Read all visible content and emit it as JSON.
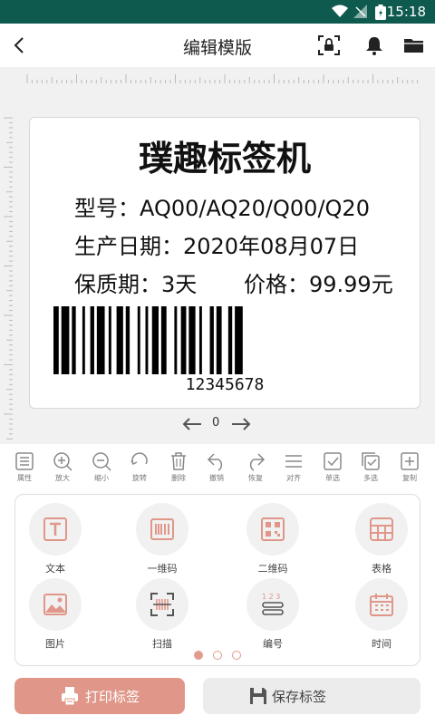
{
  "status_bar": {
    "time": "15:18"
  },
  "header": {
    "title": "编辑模版"
  },
  "label": {
    "title": "璞趣标签机",
    "model": "型号：AQ00/AQ20/Q00/Q20",
    "date": "生产日期：2020年08月07日",
    "shelf_life": "保质期：3天",
    "price": "价格：99.99元",
    "barcode_number": "12345678"
  },
  "pager": {
    "current": "0"
  },
  "toolbar": {
    "items": [
      {
        "label": "属性",
        "icon": "list-icon"
      },
      {
        "label": "放大",
        "icon": "zoom-in-icon"
      },
      {
        "label": "缩小",
        "icon": "zoom-out-icon"
      },
      {
        "label": "旋转",
        "icon": "rotate-icon"
      },
      {
        "label": "删除",
        "icon": "trash-icon"
      },
      {
        "label": "撤销",
        "icon": "undo-icon"
      },
      {
        "label": "恢复",
        "icon": "redo-icon"
      },
      {
        "label": "对齐",
        "icon": "align-icon"
      },
      {
        "label": "单选",
        "icon": "checkbox-icon"
      },
      {
        "label": "多选",
        "icon": "multi-select-icon"
      },
      {
        "label": "复制",
        "icon": "copy-icon"
      }
    ]
  },
  "panel": {
    "items": [
      {
        "label": "文本",
        "icon": "text-icon"
      },
      {
        "label": "一维码",
        "icon": "barcode-icon"
      },
      {
        "label": "二维码",
        "icon": "qrcode-icon"
      },
      {
        "label": "表格",
        "icon": "table-icon"
      },
      {
        "label": "图片",
        "icon": "image-icon"
      },
      {
        "label": "扫描",
        "icon": "scan-icon"
      },
      {
        "label": "编号",
        "icon": "numbering-icon"
      },
      {
        "label": "时间",
        "icon": "calendar-icon"
      }
    ],
    "page_dots": 3,
    "active_dot": 1
  },
  "actions": {
    "print": "打印标签",
    "save": "保存标签"
  },
  "colors": {
    "status_bar": "#0f5a4f",
    "accent": "#e0978a"
  }
}
